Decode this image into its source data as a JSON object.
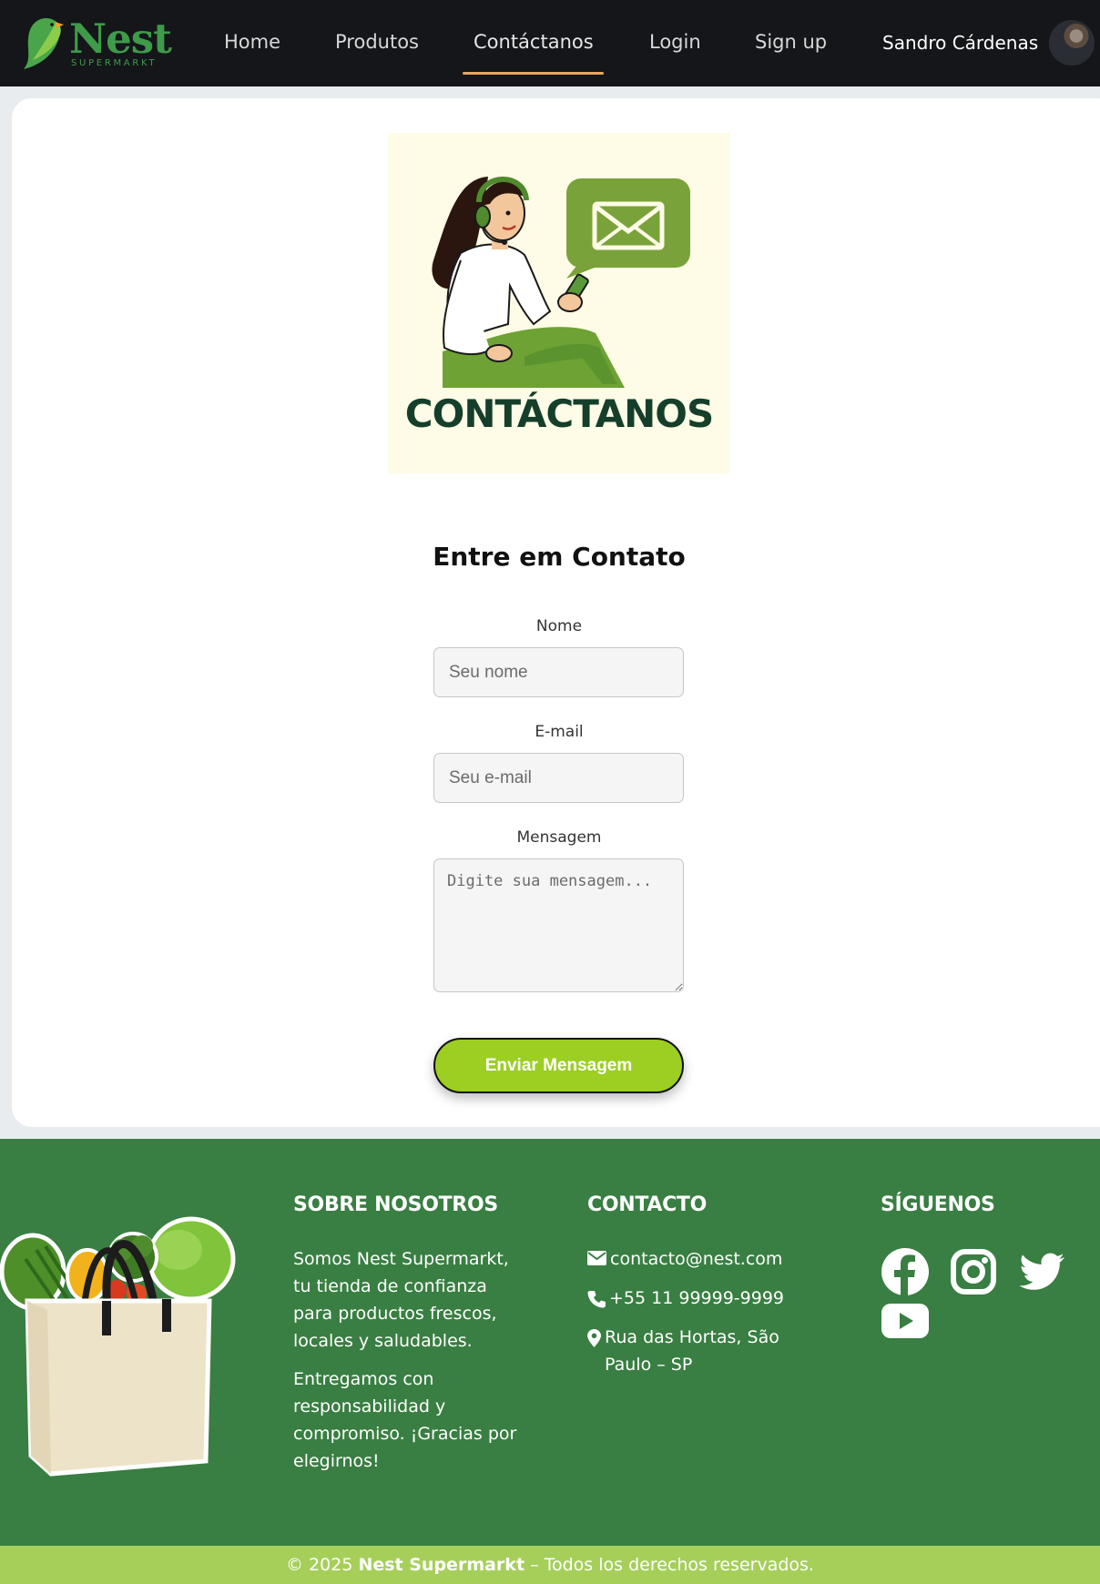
{
  "brand": {
    "name": "Nest",
    "subtitle": "SUPERMARKT"
  },
  "nav": {
    "items": [
      {
        "label": "Home"
      },
      {
        "label": "Produtos"
      },
      {
        "label": "Contáctanos",
        "active": true
      },
      {
        "label": "Login"
      },
      {
        "label": "Sign up"
      }
    ],
    "user_name": "Sandro Cárdenas"
  },
  "hero": {
    "title": "CONTÁCTANOS",
    "illustration": "support-agent-with-envelope-illustration"
  },
  "form": {
    "title": "Entre em Contato",
    "name": {
      "label": "Nome",
      "placeholder": "Seu nome",
      "value": ""
    },
    "email": {
      "label": "E-mail",
      "placeholder": "Seu e-mail",
      "value": ""
    },
    "message": {
      "label": "Mensagem",
      "placeholder": "Digite sua mensagem...",
      "value": ""
    },
    "submit_label": "Enviar Mensagem"
  },
  "footer": {
    "about": {
      "heading": "SOBRE NOSOTROS",
      "paragraphs": [
        "Somos Nest Supermarkt, tu tienda de confianza para productos frescos, locales y saludables.",
        "Entregamos con responsabilidad y compromiso. ¡Gracias por elegirnos!"
      ]
    },
    "contact": {
      "heading": "CONTACTO",
      "email": "contacto@nest.com",
      "phone": "+55 11 99999-9999",
      "address": "Rua das Hortas, São Paulo – SP"
    },
    "social": {
      "heading": "SÍGUENOS",
      "networks": [
        "facebook-icon",
        "instagram-icon",
        "twitter-icon",
        "youtube-icon"
      ]
    },
    "copyright": {
      "prefix": "© 2025 ",
      "brand": "Nest Supermarkt",
      "suffix": " – Todos los derechos reservados."
    }
  },
  "colors": {
    "navbar": "#141619",
    "accent_underline": "#e8a95a",
    "brand_green": "#3f9a4a",
    "footer_green": "#397e42",
    "button_lime": "#9ccf22",
    "copyright_bar": "#a6cf5a"
  }
}
